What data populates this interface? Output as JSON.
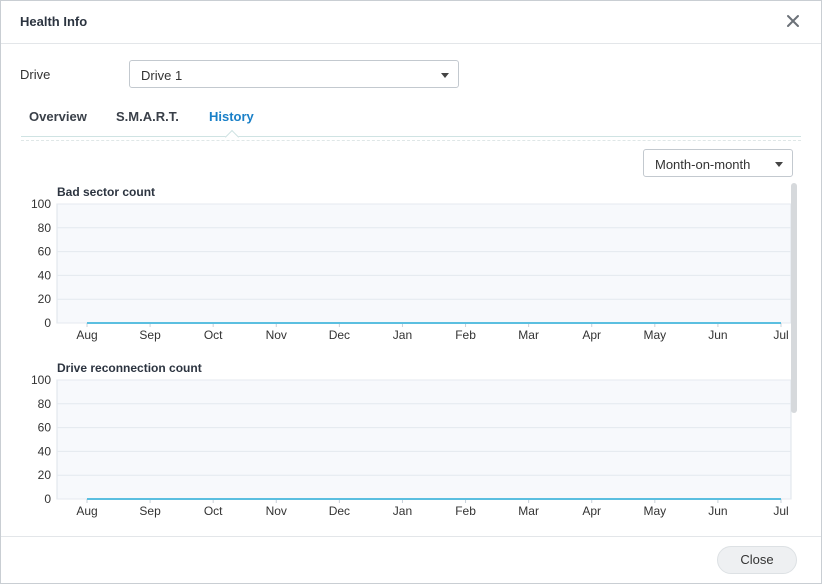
{
  "window": {
    "title": "Health Info"
  },
  "drive": {
    "label": "Drive",
    "selected": "Drive 1"
  },
  "tabs": [
    {
      "label": "Overview",
      "active": false
    },
    {
      "label": "S.M.A.R.T.",
      "active": false
    },
    {
      "label": "History",
      "active": true
    }
  ],
  "period": {
    "selected": "Month-on-month"
  },
  "footer": {
    "close_label": "Close"
  },
  "colors": {
    "accent": "#1a80c8",
    "line": "#5bbfe0",
    "plot_bg": "#f7f9fc"
  },
  "chart_data": [
    {
      "type": "line",
      "title": "Bad sector count",
      "categories": [
        "Aug",
        "Sep",
        "Oct",
        "Nov",
        "Dec",
        "Jan",
        "Feb",
        "Mar",
        "Apr",
        "May",
        "Jun",
        "Jul"
      ],
      "series": [
        {
          "values": [
            0,
            0,
            0,
            0,
            0,
            0,
            0,
            0,
            0,
            0,
            0,
            0
          ]
        }
      ],
      "ylim": [
        0,
        100
      ],
      "yticks": [
        0,
        20,
        40,
        60,
        80,
        100
      ],
      "grid": true
    },
    {
      "type": "line",
      "title": "Drive reconnection count",
      "categories": [
        "Aug",
        "Sep",
        "Oct",
        "Nov",
        "Dec",
        "Jan",
        "Feb",
        "Mar",
        "Apr",
        "May",
        "Jun",
        "Jul"
      ],
      "series": [
        {
          "values": [
            0,
            0,
            0,
            0,
            0,
            0,
            0,
            0,
            0,
            0,
            0,
            0
          ]
        }
      ],
      "ylim": [
        0,
        100
      ],
      "yticks": [
        0,
        20,
        40,
        60,
        80,
        100
      ],
      "grid": true
    }
  ]
}
